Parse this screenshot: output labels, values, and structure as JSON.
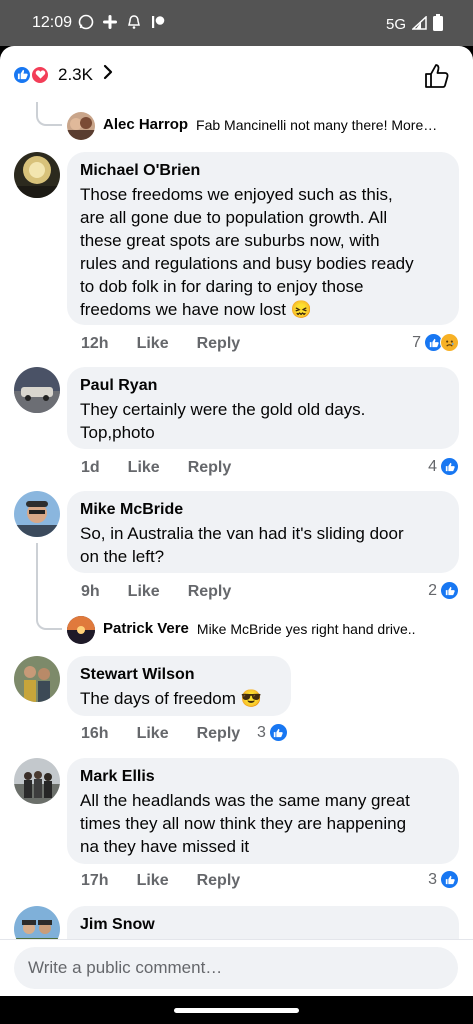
{
  "status_bar": {
    "time": "12:09",
    "network": "5G"
  },
  "header": {
    "reaction_count": "2.3K",
    "chevron": "chevron-right-icon",
    "like_icon": "thumbs-up-outline-icon"
  },
  "comments": [
    {
      "id": "alec",
      "type": "reply",
      "name": "Alec Harrop",
      "text": "Fab Mancinelli  not many there! More…"
    },
    {
      "id": "michael",
      "type": "comment",
      "name": "Michael O'Brien",
      "lines": [
        "Those freedoms we enjoyed such as this,",
        "are all gone due to population growth. All",
        "these great spots are suburbs now, with",
        "rules and regulations and busy bodies ready",
        "to dob folk in for daring to enjoy those",
        "freedoms we have now lost 😖"
      ],
      "time": "12h",
      "like": "Like",
      "reply": "Reply",
      "reactions": "7"
    },
    {
      "id": "paul",
      "type": "comment",
      "name": "Paul Ryan",
      "lines": [
        "They certainly were the gold old days.",
        "Top,photo"
      ],
      "time": "1d",
      "like": "Like",
      "reply": "Reply",
      "reactions": "4"
    },
    {
      "id": "mike",
      "type": "comment",
      "name": "Mike McBride",
      "lines": [
        "So, in Australia the van had it's sliding door",
        "on the left?"
      ],
      "time": "9h",
      "like": "Like",
      "reply": "Reply",
      "reactions": "2"
    },
    {
      "id": "patrick",
      "type": "reply",
      "name": "Patrick Vere",
      "text": "Mike McBride yes right hand drive.."
    },
    {
      "id": "stewart",
      "type": "comment",
      "name": "Stewart Wilson",
      "lines": [
        "The days of freedom 😎"
      ],
      "time": "16h",
      "like": "Like",
      "reply": "Reply",
      "reactions": "3"
    },
    {
      "id": "mark",
      "type": "comment",
      "name": "Mark Ellis",
      "lines": [
        "All the headlands was the same many great",
        "times they all now think they are happening",
        "na they have missed it"
      ],
      "time": "17h",
      "like": "Like",
      "reply": "Reply",
      "reactions": "3"
    },
    {
      "id": "jim",
      "type": "comment",
      "name": "Jim Snow"
    }
  ],
  "composer": {
    "placeholder": "Write a public comment…"
  },
  "colors": {
    "accent": "#1877f2",
    "love": "#f33e58",
    "bubble": "#f0f2f5",
    "meta": "#65676b"
  }
}
